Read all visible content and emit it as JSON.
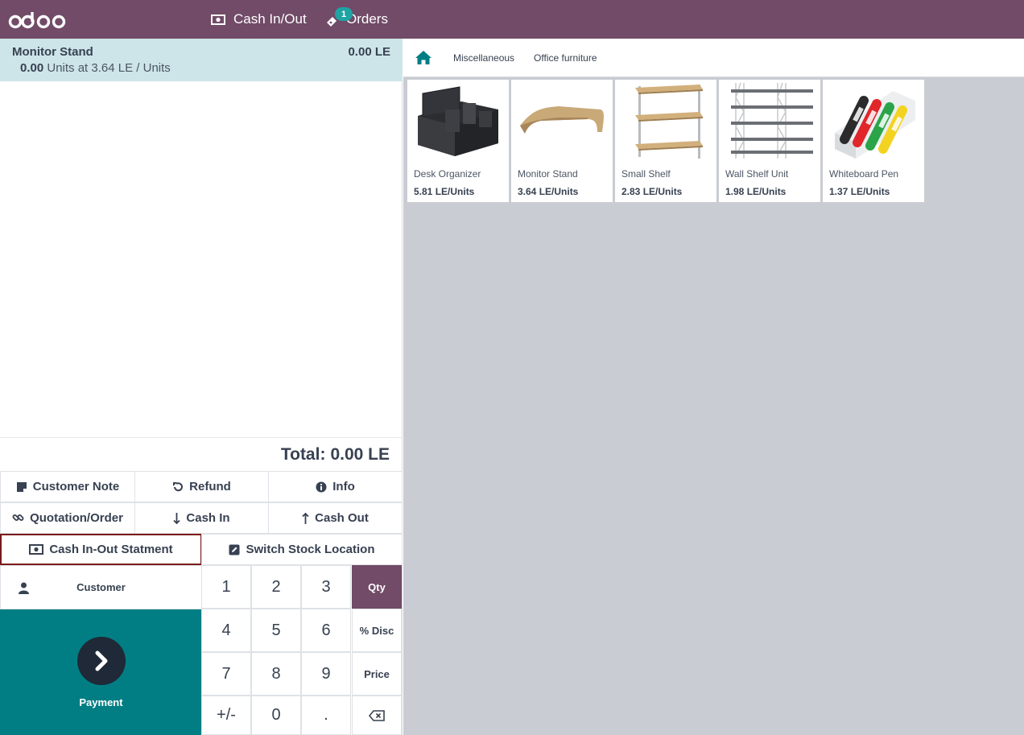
{
  "header": {
    "logo_text": "odoo",
    "cash_label": "Cash In/Out",
    "orders_label": "Orders",
    "orders_count": "1"
  },
  "order": {
    "line": {
      "name": "Monitor Stand",
      "price": "0.00 LE",
      "qty": "0.00",
      "detail": "Units at 3.64 LE / Units"
    },
    "total_label": "Total:",
    "total_value": "0.00 LE"
  },
  "controls": {
    "customer_note": "Customer Note",
    "refund": "Refund",
    "info": "Info",
    "quotation": "Quotation/Order",
    "cash_in": "Cash In",
    "cash_out": "Cash Out",
    "cash_statement": "Cash In-Out Statment",
    "switch_stock": "Switch Stock Location",
    "customer": "Customer",
    "payment": "Payment"
  },
  "numpad": {
    "keys": [
      "1",
      "2",
      "3",
      "4",
      "5",
      "6",
      "7",
      "8",
      "9",
      "+/-",
      "0",
      "."
    ],
    "modes": [
      "Qty",
      "% Disc",
      "Price"
    ],
    "active_mode": "Qty"
  },
  "categories": [
    "Miscellaneous",
    "Office furniture"
  ],
  "products": [
    {
      "name": "Desk Organizer",
      "price": "5.81 LE/Units"
    },
    {
      "name": "Monitor Stand",
      "price": "3.64 LE/Units"
    },
    {
      "name": "Small Shelf",
      "price": "2.83 LE/Units"
    },
    {
      "name": "Wall Shelf Unit",
      "price": "1.98 LE/Units"
    },
    {
      "name": "Whiteboard Pen",
      "price": "1.37 LE/Units"
    }
  ],
  "colors": {
    "brand": "#714b67",
    "teal": "#017e84",
    "selected_line": "#cde5e8",
    "badge": "#1fa3a3"
  }
}
